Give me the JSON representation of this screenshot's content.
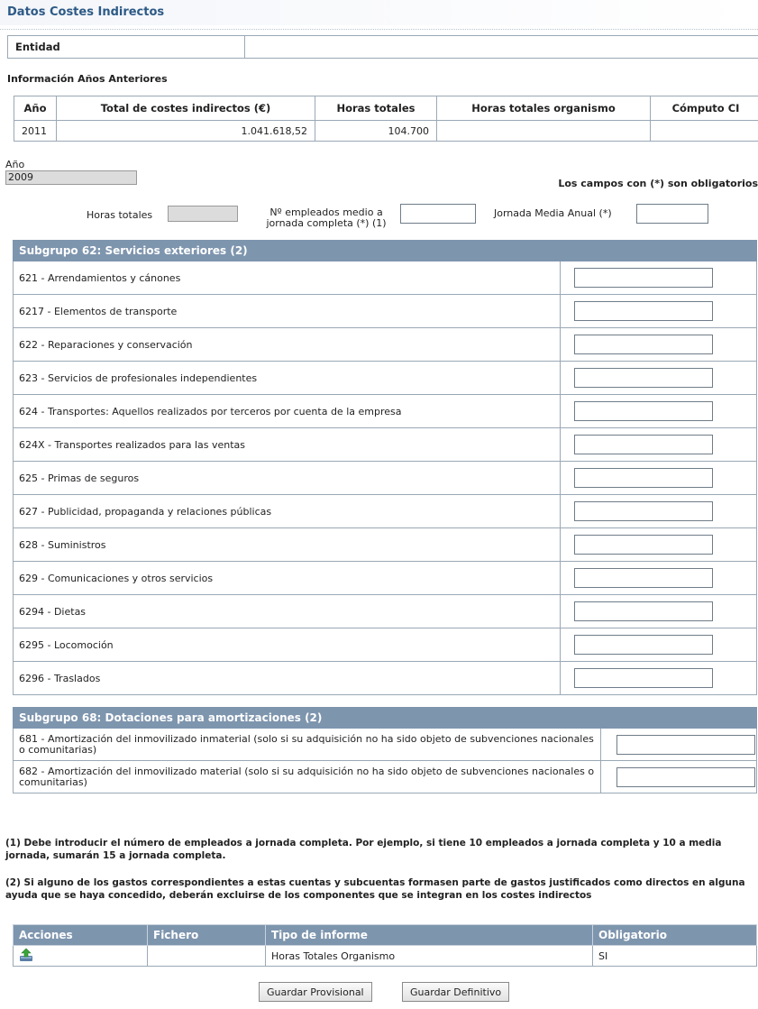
{
  "title": "Datos Costes Indirectos",
  "entidad": {
    "label": "Entidad",
    "value": ""
  },
  "prev": {
    "title": "Información Años Anteriores",
    "headers": [
      "Año",
      "Total de costes indirectos (€)",
      "Horas totales",
      "Horas totales organismo",
      "Cómputo CI"
    ],
    "rows": [
      [
        "2011",
        "1.041.618,52",
        "104.700",
        "",
        ""
      ]
    ]
  },
  "year": {
    "label": "Año",
    "value": "2009"
  },
  "required_note": "Los campos con (*) son obligatorios",
  "fields": {
    "horas_label": "Horas totales",
    "empleados_label_1": "Nº empleados medio a",
    "empleados_label_2": "jornada completa (*) (1)",
    "jornada_label": "Jornada Media Anual (*)"
  },
  "group62": {
    "title": "Subgrupo 62: Servicios exteriores (2)",
    "rows": [
      "621 - Arrendamientos y cánones",
      "6217 - Elementos de transporte",
      "622 - Reparaciones y conservación",
      "623 - Servicios de profesionales independientes",
      "624 - Transportes: Aquellos realizados por terceros por cuenta de la empresa",
      "624X - Transportes realizados para las ventas",
      "625 - Primas de seguros",
      "627 - Publicidad, propaganda y relaciones públicas",
      "628 - Suministros",
      "629 - Comunicaciones y otros servicios",
      "6294 - Dietas",
      "6295 - Locomoción",
      "6296 - Traslados"
    ]
  },
  "group68": {
    "title": "Subgrupo 68: Dotaciones para amortizaciones (2)",
    "rows": [
      "681 - Amortización del inmovilizado inmaterial (solo si su adquisición no ha sido objeto de subvenciones nacionales o comunitarias)",
      "682 - Amortización del inmovilizado material (solo si su adquisición no ha sido objeto de subvenciones nacionales o comunitarias)"
    ]
  },
  "notes": {
    "n1": "(1) Debe introducir el número de empleados a jornada completa. Por ejemplo, si tiene 10 empleados a jornada completa y 10 a media jornada, sumarán 15 a jornada completa.",
    "n2": "(2) Si alguno de los gastos correspondientes a estas cuentas y subcuentas formasen parte de gastos justificados como directos en alguna ayuda que se haya concedido, deberán excluirse de los componentes que se integran en los costes indirectos"
  },
  "reports": {
    "headers": [
      "Acciones",
      "Fichero",
      "Tipo de informe",
      "Obligatorio"
    ],
    "rows": [
      {
        "icon": "upload-icon",
        "file": "",
        "type": "Horas Totales Organismo",
        "required": "SI"
      }
    ]
  },
  "buttons": {
    "provisional": "Guardar Provisional",
    "definitivo": "Guardar Definitivo"
  },
  "colors": {
    "header_bg": "#7e95ae",
    "title": "#2d5a86",
    "readonly_bg": "#dcdcdc"
  }
}
